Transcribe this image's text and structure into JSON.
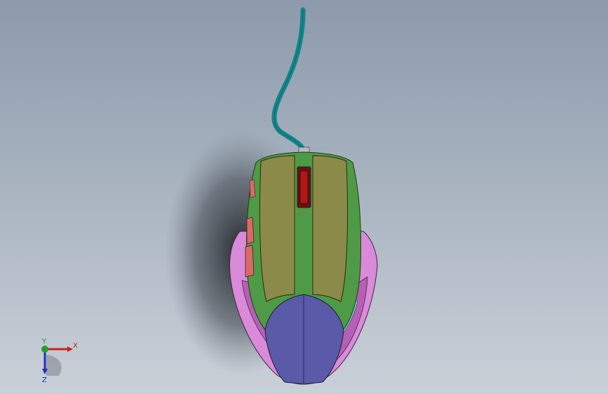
{
  "viewport": {
    "background_top": "#8c9aab",
    "background_bottom": "#c9d0d8"
  },
  "model": {
    "cable_color": "#12858a",
    "left_button_color": "#8c8a48",
    "right_button_color": "#8c8a48",
    "trim_color": "#4f9a46",
    "palm_color": "#5a5aa8",
    "side_shell_color": "#d98ad9",
    "side_buttons_color": "#d96a6a",
    "scroll_wheel_color": "#b01818",
    "accent_color": "#76c8c8"
  },
  "triad": {
    "x_label": "X",
    "y_label": "Y",
    "z_label": "Z",
    "x_color": "#cc2020",
    "y_color": "#1f9e2e",
    "z_color": "#2030c0"
  }
}
